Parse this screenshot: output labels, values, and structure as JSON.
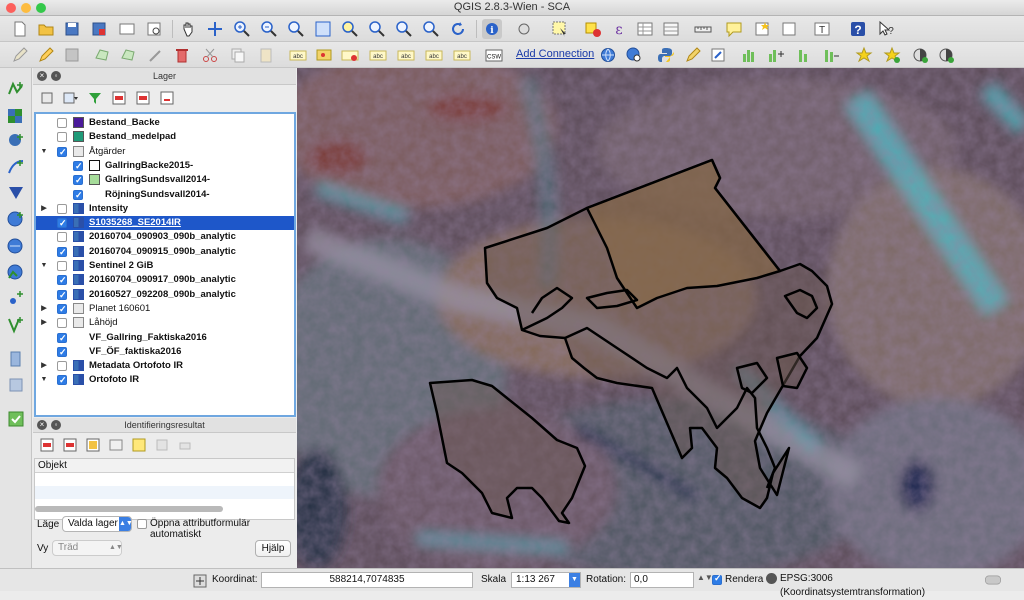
{
  "window": {
    "title": "QGIS 2.8.3-Wien - SCA",
    "traffic_colors": [
      "#fc605c",
      "#fdbc40",
      "#34c84a"
    ]
  },
  "toolbar2": {
    "add_connection_label": "Add Connection",
    "csw_label": "CSW"
  },
  "layers_panel": {
    "title": "Lager",
    "layers": [
      {
        "name": "Bestand_Backe",
        "checked": false,
        "expander": "",
        "symbol": "fill",
        "color": "#4a1a9a",
        "indent": 0,
        "bold": true
      },
      {
        "name": "Bestand_medelpad",
        "checked": false,
        "expander": "",
        "symbol": "fill",
        "color": "#1f9a78",
        "indent": 0,
        "bold": true
      },
      {
        "name": "Åtgärder",
        "checked": true,
        "expander": "open",
        "symbol": "group",
        "indent": 0,
        "bold": false
      },
      {
        "name": "GallringBacke2015-",
        "checked": true,
        "expander": "",
        "symbol": "outline",
        "color": "#ffffff",
        "indent": 1,
        "bold": true
      },
      {
        "name": "GallringSundsvall2014-",
        "checked": true,
        "expander": "",
        "symbol": "fill",
        "color": "#a6dc9a",
        "indent": 1,
        "bold": true
      },
      {
        "name": "RöjningSundsvall2014-",
        "checked": true,
        "expander": "",
        "symbol": "none",
        "indent": 1,
        "bold": true
      },
      {
        "name": "Intensity",
        "checked": false,
        "expander": "closed",
        "symbol": "raster",
        "indent": 0,
        "bold": true
      },
      {
        "name": "S1035268_SE2014IR",
        "checked": true,
        "expander": "",
        "symbol": "raster",
        "indent": 0,
        "bold": true,
        "selected": true
      },
      {
        "name": "20160704_090903_090b_analytic",
        "checked": false,
        "expander": "",
        "symbol": "raster",
        "indent": 0,
        "bold": true
      },
      {
        "name": "20160704_090915_090b_analytic",
        "checked": true,
        "expander": "",
        "symbol": "raster",
        "indent": 0,
        "bold": true
      },
      {
        "name": "Sentinel 2 GiB",
        "checked": false,
        "expander": "open",
        "symbol": "raster",
        "indent": 0,
        "bold": true
      },
      {
        "name": "20160704_090917_090b_analytic",
        "checked": true,
        "expander": "",
        "symbol": "raster",
        "indent": 0,
        "bold": true
      },
      {
        "name": "20160527_092208_090b_analytic",
        "checked": true,
        "expander": "",
        "symbol": "raster",
        "indent": 0,
        "bold": true
      },
      {
        "name": "Planet 160601",
        "checked": true,
        "expander": "closed",
        "symbol": "group",
        "indent": 0,
        "bold": false
      },
      {
        "name": "Låhöjd",
        "checked": false,
        "expander": "closed",
        "symbol": "group",
        "indent": 0,
        "bold": false
      },
      {
        "name": "VF_Gallring_Faktiska2016",
        "checked": true,
        "expander": "",
        "symbol": "none",
        "indent": 0,
        "bold": true
      },
      {
        "name": "VF_ÖF_faktiska2016",
        "checked": true,
        "expander": "",
        "symbol": "none",
        "indent": 0,
        "bold": true
      },
      {
        "name": "Metadata Ortofoto IR",
        "checked": false,
        "expander": "closed",
        "symbol": "raster",
        "indent": 0,
        "bold": true
      },
      {
        "name": "Ortofoto IR",
        "checked": true,
        "expander": "open",
        "symbol": "raster",
        "indent": 0,
        "bold": true
      }
    ]
  },
  "identify_panel": {
    "title": "Identifieringsresultat",
    "column_header": "Objekt",
    "mode_label": "Läge",
    "mode_value": "Valda lager",
    "open_form_label": "Öppna attributformulär automatiskt",
    "view_label": "Vy",
    "view_value": "Träd",
    "help_button": "Hjälp"
  },
  "statusbar": {
    "coord_label": "Koordinat:",
    "coord_value": "588214,7074835",
    "scale_label": "Skala",
    "scale_value": "1:13 267",
    "rotation_label": "Rotation:",
    "rotation_value": "0,0",
    "render_label": "Rendera",
    "crs_label": "EPSG:3006 (Koordinatsystemtransformation)"
  }
}
